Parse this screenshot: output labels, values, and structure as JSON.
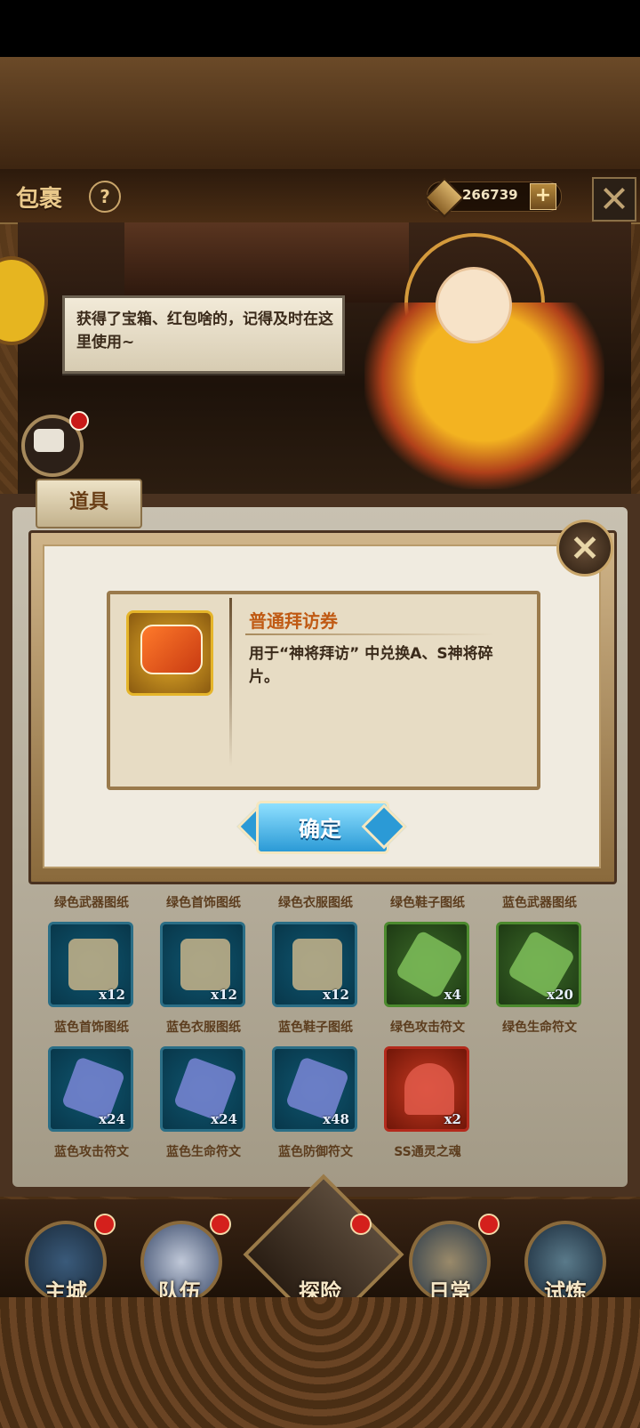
{
  "header": {
    "title": "包裹",
    "help_label": "?",
    "currency_value": "266739",
    "add_label": "+"
  },
  "npc": {
    "speech": "获得了宝箱、红包啥的，记得及时在这里使用~"
  },
  "tabs": {
    "props_label": "道具"
  },
  "grid": {
    "row1_labels": [
      "绿色武器图纸",
      "绿色首饰图纸",
      "绿色衣服图纸",
      "绿色鞋子图纸",
      "蓝色武器图纸"
    ],
    "row2": [
      {
        "label": "蓝色首饰图纸",
        "count": "x12",
        "kind": "blue",
        "icon": "blue-blueprint-icon"
      },
      {
        "label": "蓝色衣服图纸",
        "count": "x12",
        "kind": "blue",
        "icon": "blue-blueprint-icon"
      },
      {
        "label": "蓝色鞋子图纸",
        "count": "x12",
        "kind": "blue",
        "icon": "blue-blueprint-icon"
      },
      {
        "label": "绿色攻击符文",
        "count": "x4",
        "kind": "green",
        "icon": "green-rune-icon"
      },
      {
        "label": "绿色生命符文",
        "count": "x20",
        "kind": "green",
        "icon": "green-rune-icon"
      }
    ],
    "row3": [
      {
        "label": "蓝色攻击符文",
        "count": "x24",
        "kind": "blue",
        "icon": "blue-rune-icon"
      },
      {
        "label": "蓝色生命符文",
        "count": "x24",
        "kind": "blue",
        "icon": "blue-rune-icon"
      },
      {
        "label": "蓝色防御符文",
        "count": "x48",
        "kind": "blue",
        "icon": "blue-rune-icon"
      },
      {
        "label": "SS通灵之魂",
        "count": "x2",
        "kind": "red",
        "icon": "hooded-soul-icon"
      }
    ]
  },
  "dialog": {
    "item_name": "普通拜访券",
    "item_desc": "用于“神将拜访” 中兑换A、S神将碎片。",
    "confirm_label": "确定"
  },
  "nav": {
    "items": [
      "主城",
      "队伍",
      "探险",
      "日常",
      "试炼"
    ]
  },
  "colors": {
    "item_name": "#c05a14",
    "confirm_button": "#2b9ad6",
    "badge_red": "#d4201c"
  }
}
